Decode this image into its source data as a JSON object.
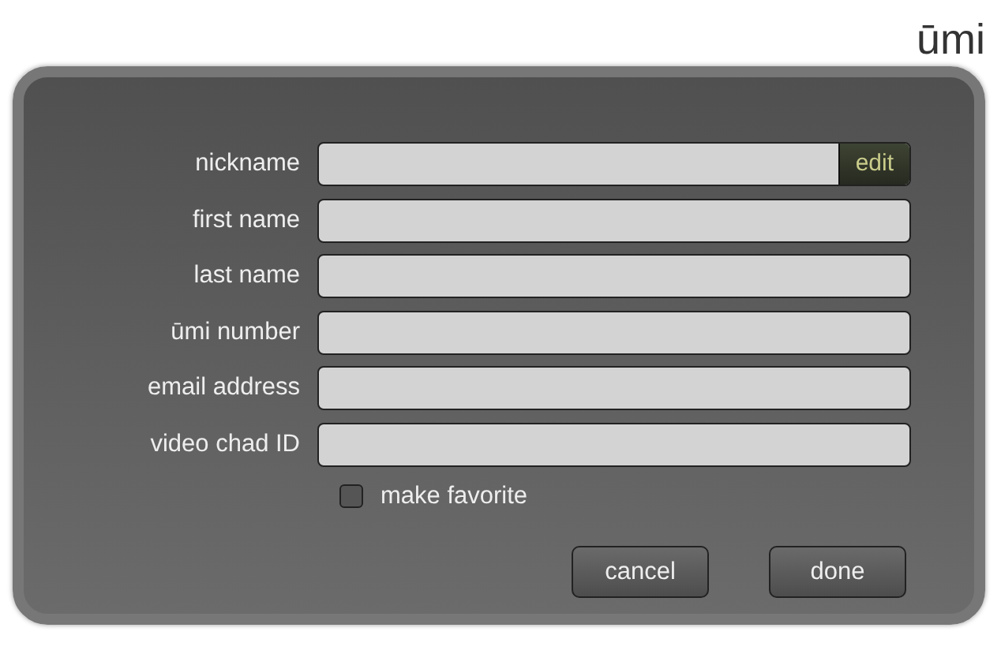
{
  "logo": "ūmi",
  "fields": [
    {
      "label": "nickname",
      "action": "edit"
    },
    {
      "label": "first name"
    },
    {
      "label": "last name"
    },
    {
      "label": "ūmi number"
    },
    {
      "label": "email address"
    },
    {
      "label": "video chad ID"
    }
  ],
  "favorite": {
    "label": "make favorite",
    "checked": false
  },
  "buttons": [
    "cancel",
    "done"
  ]
}
